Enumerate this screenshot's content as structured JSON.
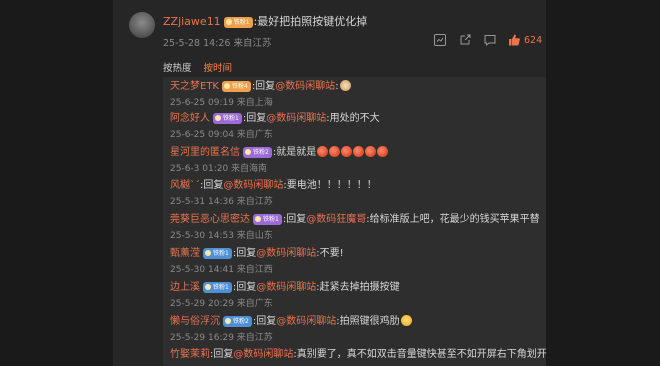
{
  "main_comment": {
    "username": "ZZjiawe11",
    "badge": "铁粉1",
    "text": ":最好把拍照按键优化掉",
    "meta": "25-5-28 14:26 来自江苏",
    "like_count": "624",
    "icons": [
      "more-icon",
      "share-icon",
      "comment-icon",
      "like-icon"
    ]
  },
  "sort_tabs": [
    {
      "label": "按热度",
      "active": false
    },
    {
      "label": "按时间",
      "active": true
    }
  ],
  "replies": [
    {
      "user": "天之梦ETK",
      "badge": "铁粉4",
      "badge_color": "#f0a04a",
      "prefix": ":回复",
      "at": "@数码闲聊站",
      "text": ":",
      "emojis": [
        "dog"
      ],
      "meta": "25-6-25 09:19 来自上海"
    },
    {
      "user": "阿念好人",
      "badge": "铁粉1",
      "badge_color": "#9b6bd6",
      "prefix": ":回复",
      "at": "@数码闲聊站",
      "text": ":用处的不大",
      "emojis": [],
      "meta": "25-6-25 09:04 来自广东"
    },
    {
      "user": "星河里的匿名信",
      "badge": "铁粉2",
      "badge_color": "#9b6bd6",
      "prefix": "",
      "at": "",
      "text": ":就是就是",
      "emojis": [
        "red",
        "red",
        "red",
        "red",
        "red",
        "red"
      ],
      "meta": "25-6-3 01:20 来自海南"
    },
    {
      "user": "风樾ˋˊ",
      "badge": "",
      "badge_color": "",
      "prefix": ":回复",
      "at": "@数码闲聊站",
      "text": ":要电池！！！！！！",
      "emojis": [],
      "meta": "25-5-31 14:36 来自江苏"
    },
    {
      "user": "莞葵巨恶心思密达",
      "badge": "铁粉1",
      "badge_color": "#9b6bd6",
      "prefix": ":回复",
      "at": "@数码狂魔哥",
      "text": ":给标准版上吧，花最少的钱买苹果平替",
      "emojis": [],
      "meta": "25-5-30 14:53 来自山东"
    },
    {
      "user": "甄薰滢",
      "badge": "铁粉1",
      "badge_color": "#4f8fd6",
      "prefix": ":回复",
      "at": "@数码闲聊站",
      "text": ":不要!",
      "emojis": [],
      "meta": "25-5-30 14:41 来自江西"
    },
    {
      "user": "边上溪",
      "badge": "铁粉1",
      "badge_color": "#4f8fd6",
      "prefix": ":回复",
      "at": "@数码闲聊站",
      "text": ":赶紧去掉拍摄按键",
      "emojis": [],
      "meta": "25-5-29 20:29 来自广东"
    },
    {
      "user": "懒与俗浮沉",
      "badge": "铁粉2",
      "badge_color": "#4f8fd6",
      "prefix": ":回复",
      "at": "@数码闲聊站",
      "text": ":拍照键很鸡肋",
      "emojis": [
        "sweat"
      ],
      "meta": "25-5-29 16:29 来自江苏"
    },
    {
      "user": "竹娶茉莉",
      "badge": "",
      "badge_color": "",
      "prefix": ":回复",
      "at": "@数码闲聊站",
      "text": ":真别要了，真不如双击音量键快甚至不如开屏右下角划开",
      "emojis": [],
      "meta": ""
    }
  ]
}
